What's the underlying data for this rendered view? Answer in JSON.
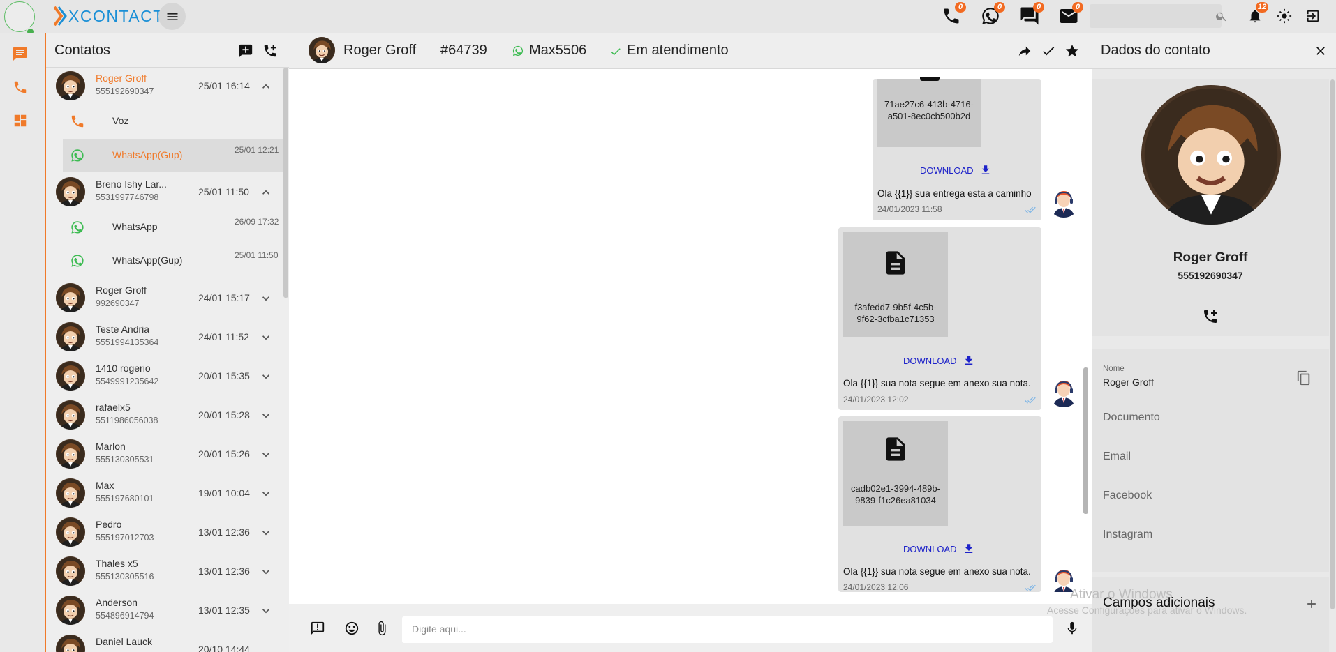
{
  "topbar": {
    "logo_text": "XCONTACT",
    "badges": {
      "phone": "0",
      "whatsapp": "0",
      "chat": "0",
      "email": "0",
      "notifications": "12"
    },
    "search_placeholder": ""
  },
  "contacts": {
    "title": "Contatos",
    "items": [
      {
        "name": "Roger Groff",
        "phone": "555192690347",
        "time": "25/01 16:14",
        "expanded": true,
        "active": true,
        "channels": [
          {
            "label": "Voz",
            "time": "",
            "icon": "phone-icon"
          },
          {
            "label": "WhatsApp(Gup)",
            "time": "25/01 12:21",
            "icon": "whatsapp-icon",
            "selected": true
          }
        ]
      },
      {
        "name": "Breno Ishy Lar...",
        "phone": "5531997746798",
        "time": "25/01 11:50",
        "expanded": true,
        "channels": [
          {
            "label": "WhatsApp",
            "time": "26/09 17:32",
            "icon": "whatsapp-icon"
          },
          {
            "label": "WhatsApp(Gup)",
            "time": "25/01 11:50",
            "icon": "whatsapp-icon"
          }
        ]
      },
      {
        "name": "Roger Groff",
        "phone": "992690347",
        "time": "24/01 15:17"
      },
      {
        "name": "Teste Andria",
        "phone": "5551994135364",
        "time": "24/01 11:52"
      },
      {
        "name": "1410 rogerio",
        "phone": "5549991235642",
        "time": "20/01 15:35"
      },
      {
        "name": "rafaelx5",
        "phone": "5511986056038",
        "time": "20/01 15:28"
      },
      {
        "name": "Marlon",
        "phone": "555130305531",
        "time": "20/01 15:26"
      },
      {
        "name": "Max",
        "phone": "555197680101",
        "time": "19/01 10:04"
      },
      {
        "name": "Pedro",
        "phone": "555197012703",
        "time": "13/01 12:36"
      },
      {
        "name": "Thales x5",
        "phone": "555130305516",
        "time": "13/01 12:36"
      },
      {
        "name": "Anderson",
        "phone": "554896914794",
        "time": "13/01 12:35"
      },
      {
        "name": "Daniel Lauck",
        "phone": "",
        "time": "20/10 14:44"
      }
    ]
  },
  "chat": {
    "contact_name": "Roger Groff",
    "ticket": "#64739",
    "channel": "Max5506",
    "status": "Em atendimento",
    "messages": [
      {
        "file": "71ae27c6-413b-4716-a501-8ec0cb500b2d",
        "download": "DOWNLOAD",
        "text": "Ola {{1}} sua entrega esta a caminho",
        "date": "24/01/2023 11:58"
      },
      {
        "file": "f3afedd7-9b5f-4c5b-9f62-3cfba1c71353",
        "download": "DOWNLOAD",
        "text": "Ola {{1}} sua nota segue em anexo sua nota.",
        "date": "24/01/2023 12:02"
      },
      {
        "file": "cadb02e1-3994-489b-9839-f1c26ea81034",
        "download": "DOWNLOAD",
        "text": "Ola {{1}} sua nota segue em anexo sua nota.",
        "date": "24/01/2023 12:06"
      }
    ],
    "input_placeholder": "Digite aqui..."
  },
  "details": {
    "title": "Dados do contato",
    "name": "Roger Groff",
    "phone": "555192690347",
    "nome_label": "Nome",
    "nome_value": "Roger Groff",
    "fields": [
      "Documento",
      "Email",
      "Facebook",
      "Instagram"
    ],
    "extra_title": "Campos adicionais"
  },
  "watermark": {
    "line1": "Ativar o Windows",
    "line2": "Acesse Configurações para ativar o Windows."
  },
  "colors": {
    "accent": "#f07a2a",
    "whatsapp": "#3dbb52",
    "link": "#1d22c9",
    "status_check": "#3dbb52"
  }
}
